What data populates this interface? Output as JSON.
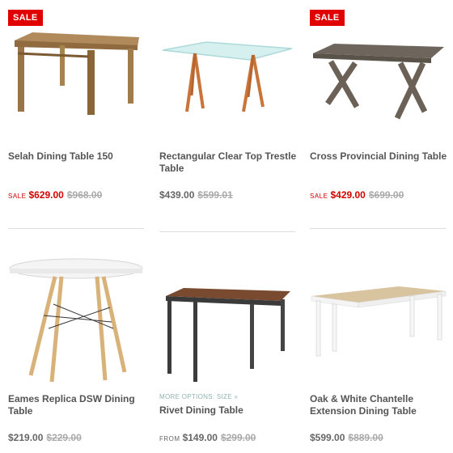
{
  "products": [
    {
      "name": "Selah Dining Table 150",
      "badge": "SALE",
      "price_label": "SALE",
      "price": "$629.00",
      "was": "$968.00",
      "image": "rustic-timber-table"
    },
    {
      "name": "Rectangular Clear Top Trestle Table",
      "price": "$439.00",
      "was": "$599.01",
      "image": "glass-trestle-table"
    },
    {
      "name": "Cross Provincial Dining Table",
      "badge": "SALE",
      "price_label": "SALE",
      "price": "$429.00",
      "was": "$699.00",
      "image": "cross-leg-table"
    },
    {
      "name": "Eames Replica DSW Dining Table",
      "price": "$219.00",
      "was": "$229.00",
      "image": "round-white-table"
    },
    {
      "name": "Rivet Dining Table",
      "more_options": "MORE OPTIONS: SIZE »",
      "price_label": "FROM",
      "price": "$149.00",
      "was": "$299.00",
      "image": "industrial-table"
    },
    {
      "name": "Oak & White Chantelle Extension Dining Table",
      "price": "$599.00",
      "was": "$889.00",
      "image": "oak-white-table"
    }
  ],
  "colors": {
    "sale_red": "#d40000",
    "badge_red": "#e00000",
    "price_grey": "#666666",
    "was_grey": "#aaaaaa",
    "options_teal": "#8fb3b0"
  }
}
